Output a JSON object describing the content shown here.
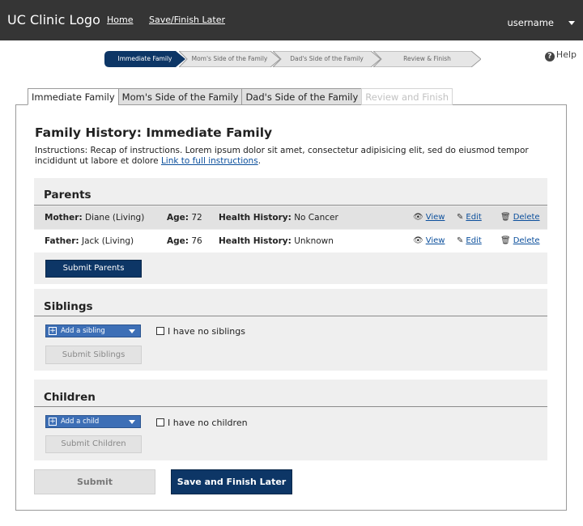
{
  "header": {
    "logo": "UC Clinic Logo",
    "home_link": "Home",
    "save_link": "Save/Finish Later",
    "username": "username"
  },
  "progress": {
    "steps": [
      {
        "label": "Immediate Family",
        "active": true
      },
      {
        "label": "Mom's Side of the Family",
        "active": false
      },
      {
        "label": "Dad's Side of the Family",
        "active": false
      },
      {
        "label": "Review & Finish",
        "active": false
      }
    ],
    "help": "Help"
  },
  "tabs": [
    {
      "label": "Immediate Family",
      "state": "active"
    },
    {
      "label": "Mom's Side of the Family",
      "state": "normal"
    },
    {
      "label": "Dad's Side of the Family",
      "state": "normal"
    },
    {
      "label": "Review and Finish",
      "state": "disabled"
    }
  ],
  "page": {
    "title": "Family History: Immediate Family",
    "instructions": "Instructions:  Recap of instructions. Lorem ipsum dolor sit amet, consectetur adipisicing elit, sed do eiusmod tempor incididunt ut labore et dolore",
    "instructions_link": "Link to full instructions",
    "instructions_end": "."
  },
  "parents": {
    "heading": "Parents",
    "rows": [
      {
        "relation": "Mother:",
        "name": "Diane (Living)",
        "age_label": "Age:",
        "age": "72",
        "health_label": "Health History:",
        "health": "No Cancer"
      },
      {
        "relation": "Father:",
        "name": "Jack (Living)",
        "age_label": "Age:",
        "age": "76",
        "health_label": "Health History:",
        "health": "Unknown"
      }
    ],
    "actions": {
      "view": "View",
      "edit": "Edit",
      "delete": "Delete"
    },
    "submit": "Submit Parents"
  },
  "siblings": {
    "heading": "Siblings",
    "add": "Add a sibling",
    "none": "I have no siblings",
    "submit": "Submit Siblings"
  },
  "children": {
    "heading": "Children",
    "add": "Add a child",
    "none": "I have no children",
    "submit": "Submit Children"
  },
  "footer": {
    "submit": "Submit",
    "save_later": "Save and Finish Later"
  },
  "colors": {
    "topbar": "#353535",
    "step_active": "#0d3666",
    "primary_button": "#0d3666",
    "add_dropdown": "#3d6fb6",
    "link": "#0b4f9c"
  }
}
